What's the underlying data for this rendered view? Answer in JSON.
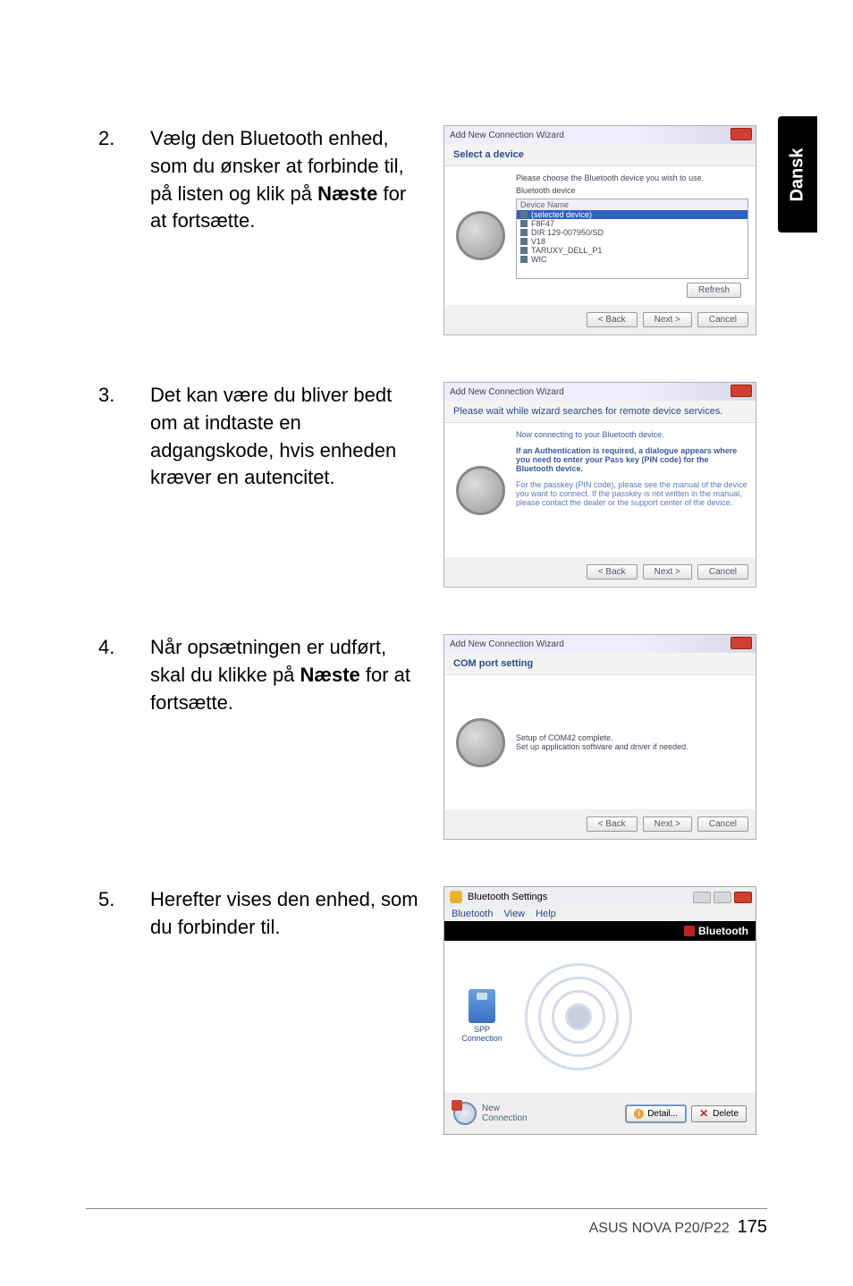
{
  "side_tab": "Dansk",
  "steps": [
    {
      "num": "2.",
      "text_before": "Vælg den Bluetooth enhed, som du ønsker at forbinde til, på listen og klik på ",
      "text_bold": "Næste",
      "text_after": " for at fortsætte."
    },
    {
      "num": "3.",
      "text_before": "Det kan være du bliver bedt om at indtaste en adgangskode, hvis enheden kræver en autencitet.",
      "text_bold": "",
      "text_after": ""
    },
    {
      "num": "4.",
      "text_before": "Når opsætningen er udført, skal du klikke på ",
      "text_bold": "Næste",
      "text_after": " for at fortsætte."
    },
    {
      "num": "5.",
      "text_before": "Herefter vises den enhed, som du forbinder til.",
      "text_bold": "",
      "text_after": ""
    }
  ],
  "wizard1": {
    "title": "Add New Connection Wizard",
    "heading": "Select a device",
    "instr": "Please choose the Bluetooth device you wish to use.",
    "label": "Bluetooth device",
    "col": "Device Name",
    "items": [
      "(selected device)",
      "F8F47",
      "DIR 129-007950/SD",
      "V18",
      "TARUXY_DELL_P1",
      "WIC"
    ],
    "refresh": "Refresh",
    "back": "< Back",
    "next": "Next >",
    "cancel": "Cancel"
  },
  "wizard2": {
    "title": "Add New Connection Wizard",
    "heading": "Please wait while wizard searches for remote device services.",
    "line1": "Now connecting to your Bluetooth device.",
    "line2": "If an Authentication is required, a dialogue appears where you need to enter your Pass key (PIN code) for the Bluetooth device.",
    "line3": "For the passkey (PIN code), please see the manual of the device you want to connect. If the passkey is not written in the manual, please contact the dealer or the support center of the device.",
    "back": "< Back",
    "next": "Next >",
    "cancel": "Cancel"
  },
  "wizard3": {
    "title": "Add New Connection Wizard",
    "heading": "COM port setting",
    "line1": "Setup of COM42 complete.",
    "line2": "Set up application software and driver if needed.",
    "back": "< Back",
    "next": "Next >",
    "cancel": "Cancel"
  },
  "btwin": {
    "title": "Bluetooth Settings",
    "menu": [
      "Bluetooth",
      "View",
      "Help"
    ],
    "brand": "Bluetooth",
    "spp_label1": "SPP",
    "spp_label2": "Connection",
    "newcon1": "New",
    "newcon2": "Connection",
    "detail": "Detail...",
    "delete": "Delete"
  },
  "footer": {
    "product": "ASUS NOVA P20/P22",
    "page": "175"
  }
}
